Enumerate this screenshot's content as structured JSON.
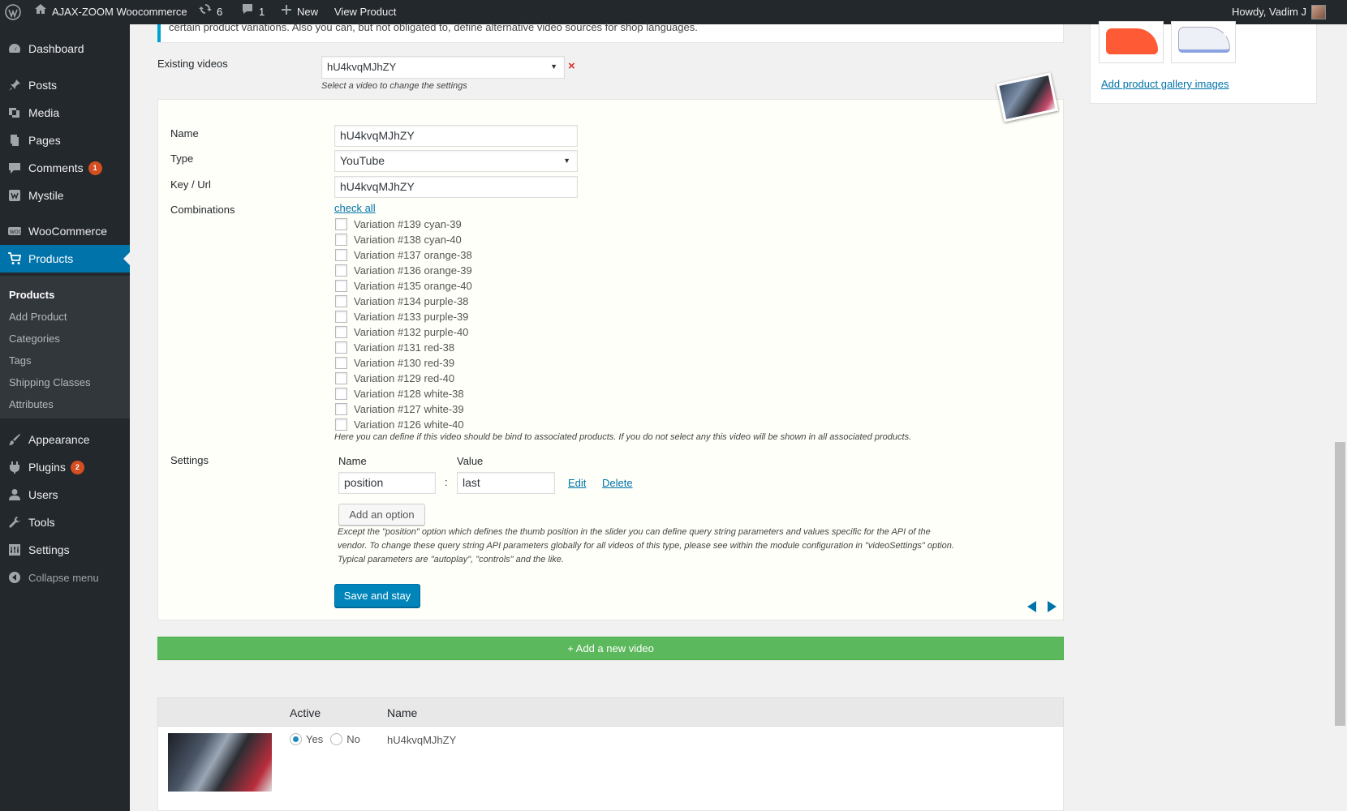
{
  "adminbar": {
    "site_name": "AJAX-ZOOM Woocommerce",
    "updates_count": "6",
    "comments_count": "1",
    "new_label": "New",
    "view_label": "View Product",
    "greeting": "Howdy, Vadim J"
  },
  "sidebar": {
    "items": [
      {
        "label": "Dashboard",
        "icon": "dashboard-icon"
      },
      {
        "label": "Posts",
        "icon": "pin-icon"
      },
      {
        "label": "Media",
        "icon": "media-icon"
      },
      {
        "label": "Pages",
        "icon": "pages-icon"
      },
      {
        "label": "Comments",
        "icon": "comment-icon",
        "badge": "1"
      },
      {
        "label": "Mystile",
        "icon": "theme-icon"
      },
      {
        "label": "WooCommerce",
        "icon": "woo-icon"
      },
      {
        "label": "Products",
        "icon": "cart-icon"
      },
      {
        "label": "Appearance",
        "icon": "brush-icon"
      },
      {
        "label": "Plugins",
        "icon": "plugin-icon",
        "badge": "2"
      },
      {
        "label": "Users",
        "icon": "user-icon"
      },
      {
        "label": "Tools",
        "icon": "wrench-icon"
      },
      {
        "label": "Settings",
        "icon": "settings-icon"
      }
    ],
    "submenu": [
      "Products",
      "Add Product",
      "Categories",
      "Tags",
      "Shipping Classes",
      "Attributes"
    ],
    "collapse_label": "Collapse menu"
  },
  "notice": {
    "text": "certain product variations. Also you can, but not obligated to, define alternative video sources for shop languages."
  },
  "existing_videos": {
    "label": "Existing videos",
    "selected": "hU4kvqMJhZY",
    "hint": "Select a video to change the settings",
    "remove_symbol": "×"
  },
  "form": {
    "name_label": "Name",
    "name_value": "hU4kvqMJhZY",
    "type_label": "Type",
    "type_value": "YouTube",
    "key_label": "Key / Url",
    "key_value": "hU4kvqMJhZY",
    "combinations_label": "Combinations",
    "check_all": "check all",
    "combinations": [
      "Variation #139 cyan-39",
      "Variation #138 cyan-40",
      "Variation #137 orange-38",
      "Variation #136 orange-39",
      "Variation #135 orange-40",
      "Variation #134 purple-38",
      "Variation #133 purple-39",
      "Variation #132 purple-40",
      "Variation #131 red-38",
      "Variation #130 red-39",
      "Variation #129 red-40",
      "Variation #128 white-38",
      "Variation #127 white-39",
      "Variation #126 white-40"
    ],
    "combinations_hint": "Here you can define if this video should be bind to associated products. If you do not select any this video will be shown in all associated products.",
    "settings_label": "Settings",
    "settings_name_header": "Name",
    "settings_value_header": "Value",
    "option_name": "position",
    "option_separator": ":",
    "option_value": "last",
    "edit_link": "Edit",
    "delete_link": "Delete",
    "add_option_button": "Add an option",
    "settings_hint_1": "Except the \"position\" option which defines the thumb position in the slider you can define query string parameters and values specific for the API of the",
    "settings_hint_2": "vendor. To change these query string API parameters globally for all videos of this type, please see within the module configuration in \"videoSettings\" option.",
    "settings_hint_3": "Typical parameters are \"autoplay\", \"controls\" and the like.",
    "save_button": "Save and stay"
  },
  "add_video_button": "+ Add a new video",
  "video_table": {
    "col_active": "Active",
    "col_name": "Name",
    "rows": [
      {
        "active": "Yes",
        "inactive": "No",
        "name": "hU4kvqMJhZY"
      }
    ]
  },
  "gallery": {
    "add_link": "Add product gallery images"
  },
  "colors": {
    "admin_bar": "#23282d",
    "active_menu": "#0073aa",
    "primary_button": "#0085ba",
    "add_video": "#5cb85c",
    "badge": "#d54e21"
  }
}
